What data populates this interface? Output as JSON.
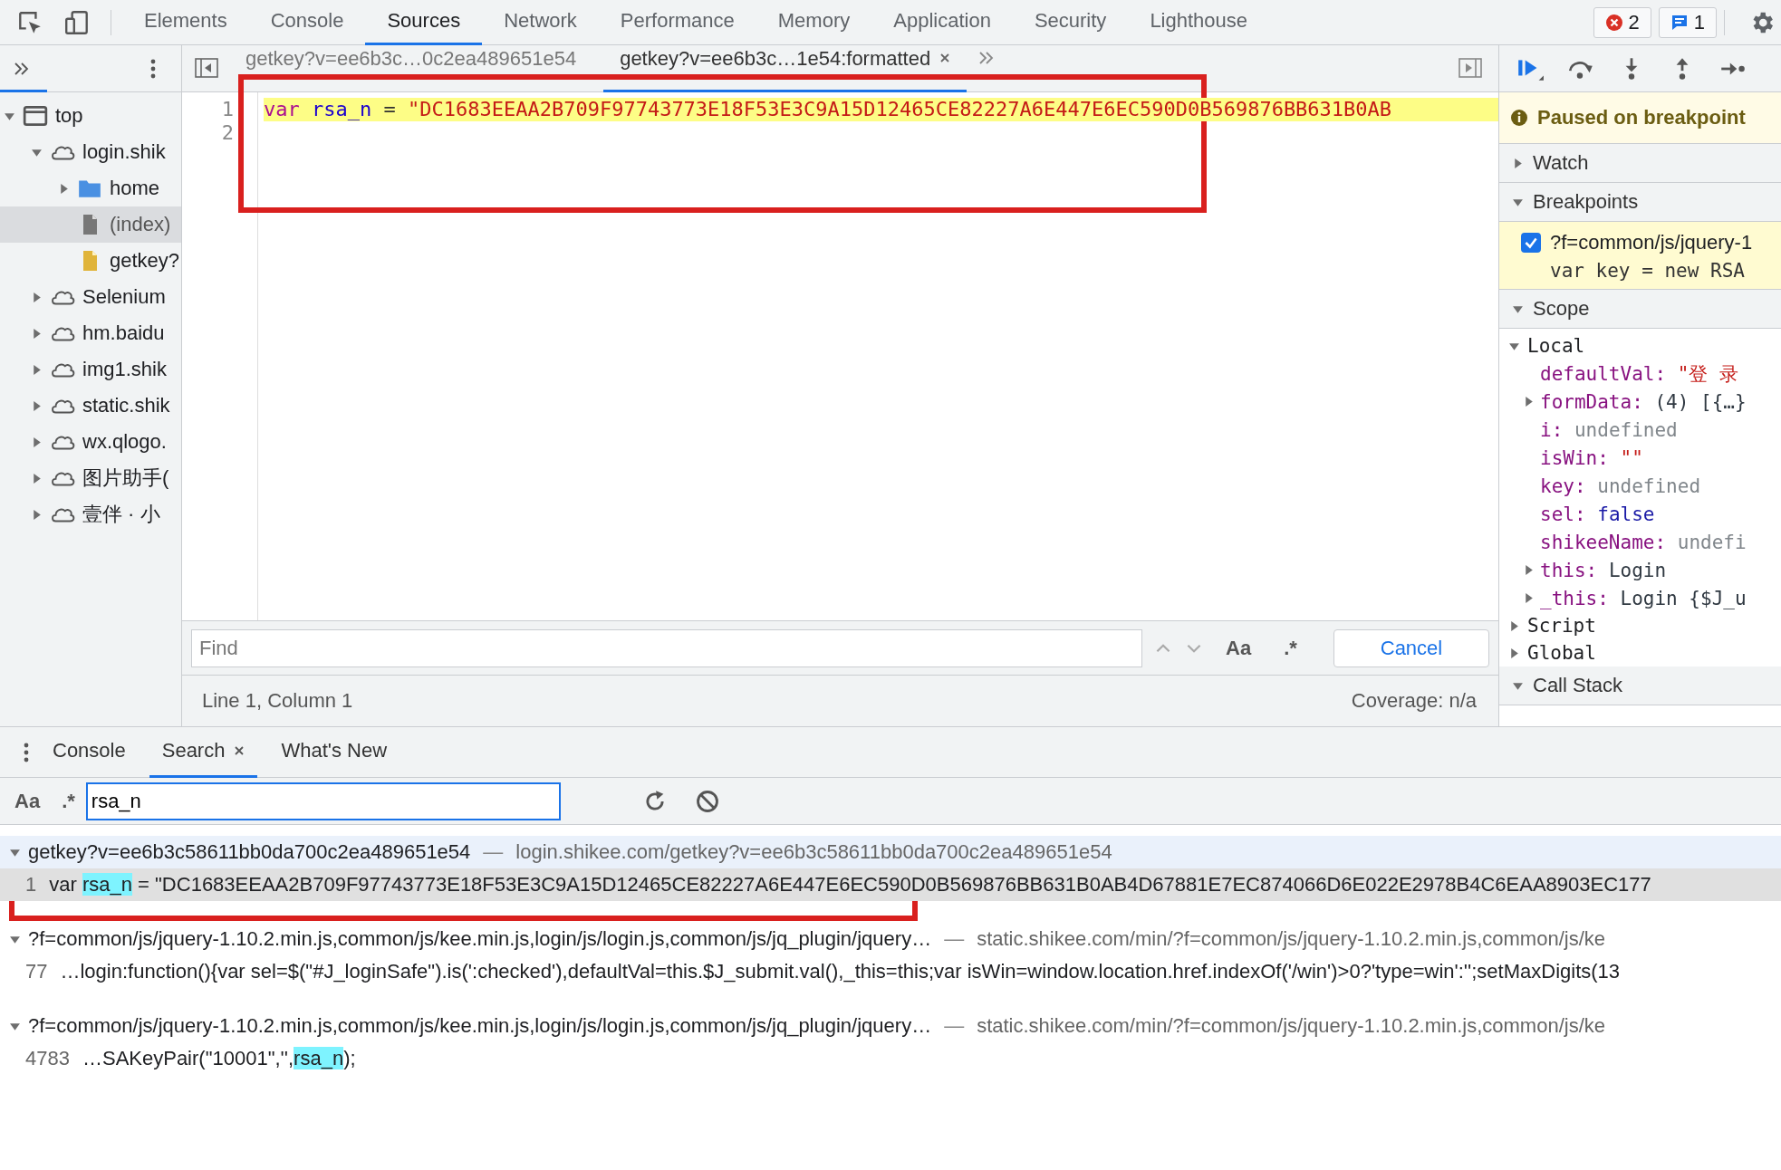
{
  "toolbar": {
    "tabs": [
      {
        "label": "Elements",
        "selected": false
      },
      {
        "label": "Console",
        "selected": false
      },
      {
        "label": "Sources",
        "selected": true
      },
      {
        "label": "Network",
        "selected": false
      },
      {
        "label": "Performance",
        "selected": false
      },
      {
        "label": "Memory",
        "selected": false
      },
      {
        "label": "Application",
        "selected": false
      },
      {
        "label": "Security",
        "selected": false
      },
      {
        "label": "Lighthouse",
        "selected": false
      }
    ],
    "errors": "2",
    "messages": "1"
  },
  "navigator": {
    "tree": [
      {
        "label": "top",
        "kind": "frame",
        "expanded": true,
        "selected": false,
        "children": [
          {
            "label": "login.shik",
            "kind": "domain",
            "expanded": true,
            "selected": false,
            "children": [
              {
                "label": "home",
                "kind": "folder",
                "expanded": false,
                "selected": false
              },
              {
                "label": "(index)",
                "kind": "file",
                "selected": true
              },
              {
                "label": "getkey?",
                "kind": "script",
                "selected": false
              }
            ]
          },
          {
            "label": "Selenium",
            "kind": "domain",
            "expanded": false,
            "selected": false
          },
          {
            "label": "hm.baidu",
            "kind": "domain",
            "expanded": false,
            "selected": false
          },
          {
            "label": "img1.shik",
            "kind": "domain",
            "expanded": false,
            "selected": false
          },
          {
            "label": "static.shik",
            "kind": "domain",
            "expanded": false,
            "selected": false
          },
          {
            "label": "wx.qlogo.",
            "kind": "domain",
            "expanded": false,
            "selected": false
          },
          {
            "label": "图片助手(",
            "kind": "domain",
            "expanded": false,
            "selected": false
          },
          {
            "label": "壹伴 · 小",
            "kind": "domain",
            "expanded": false,
            "selected": false
          }
        ]
      }
    ]
  },
  "editor": {
    "tabs": [
      {
        "label": "getkey?v=ee6b3c…0c2ea489651e54",
        "selected": false
      },
      {
        "label": "getkey?v=ee6b3c…1e54:formatted",
        "selected": true
      }
    ],
    "lines": [
      {
        "number": "1",
        "highlighted": true,
        "tokens": [
          {
            "kind": "keyword",
            "text": "var"
          },
          {
            "kind": "variable",
            "text": "rsa_n"
          },
          {
            "kind": "operator",
            "text": "="
          },
          {
            "kind": "string",
            "text": "\"DC1683EEAA2B709F97743773E18F53E3C9A15D12465CE82227A6E447E6EC590D0B569876BB631B0AB"
          }
        ]
      },
      {
        "number": "2",
        "highlighted": false
      }
    ],
    "find": {
      "placeholder": "Find",
      "match_case": "Aa",
      "regex": ".*",
      "cancel": "Cancel"
    },
    "status": {
      "position": "Line 1, Column 1",
      "coverage": "Coverage: n/a"
    }
  },
  "debugger": {
    "banner": "Paused on breakpoint",
    "sections": [
      {
        "title": "Watch",
        "expanded": false
      },
      {
        "title": "Breakpoints",
        "expanded": true
      },
      {
        "title": "Scope",
        "expanded": true
      },
      {
        "title": "Call Stack",
        "expanded": true
      }
    ],
    "breakpoint": {
      "file": "?f=common/js/jquery-1",
      "code": "var key = new RSA",
      "checked": true
    },
    "scopes": [
      {
        "label": "Local",
        "expanded": true,
        "variables": [
          {
            "name": "defaultVal:",
            "value": "\"登  录",
            "kind": "string"
          },
          {
            "name": "formData:",
            "value": "(4) [{…}",
            "kind": "object",
            "expanded": false
          },
          {
            "name": "i:",
            "value": "undefined",
            "kind": "undefined"
          },
          {
            "name": "isWin:",
            "value": "\"\"",
            "kind": "string"
          },
          {
            "name": "key:",
            "value": "undefined",
            "kind": "undefined"
          },
          {
            "name": "sel:",
            "value": "false",
            "kind": "boolean"
          },
          {
            "name": "shikeeName:",
            "value": "undefi",
            "kind": "undefined"
          },
          {
            "name": "this:",
            "value": "Login",
            "kind": "object",
            "expanded": false
          },
          {
            "name": "_this:",
            "value": "Login {$J_u",
            "kind": "object",
            "expanded": false
          }
        ]
      },
      {
        "label": "Script",
        "expanded": false
      },
      {
        "label": "Global",
        "expanded": false
      }
    ]
  },
  "drawer": {
    "tabs": [
      {
        "label": "Console",
        "selected": false,
        "closable": false
      },
      {
        "label": "Search",
        "selected": true,
        "closable": true
      },
      {
        "label": "What's New",
        "selected": false,
        "closable": false
      }
    ],
    "search": {
      "match_case": "Aa",
      "regex": ".*",
      "value": "rsa_n"
    },
    "results": [
      {
        "file": "getkey?v=ee6b3c58611bb0da700c2ea489651e54",
        "separator": "—",
        "url": "login.shikee.com/getkey?v=ee6b3c58611bb0da700c2ea489651e54",
        "expanded": true,
        "selected": true,
        "matches": [
          {
            "line": "1",
            "selected": true,
            "segments": [
              {
                "text": "var ",
                "match": false
              },
              {
                "text": "rsa_n",
                "match": true
              },
              {
                "text": " = \"DC1683EEAA2B709F97743773E18F53E3C9A15D12465CE82227A6E447E6EC590D0B569876BB631B0AB4D67881E7EC874066D6E022E2978B4C6EAA8903EC177",
                "match": false
              }
            ]
          }
        ]
      },
      {
        "file": "?f=common/js/jquery-1.10.2.min.js,common/js/kee.min.js,login/js/login.js,common/js/jq_plugin/jquery…",
        "separator": "—",
        "url": "static.shikee.com/min/?f=common/js/jquery-1.10.2.min.js,common/js/ke",
        "expanded": true,
        "selected": false,
        "matches": [
          {
            "line": "77",
            "selected": false,
            "segments": [
              {
                "text": "…login:function(){var sel=$(\"#J_loginSafe\").is(':checked'),defaultVal=this.$J_submit.val(),_this=this;var isWin=window.location.href.indexOf('/win')>0?'type=win':'';setMaxDigits(13",
                "match": false
              }
            ]
          }
        ]
      },
      {
        "file": "?f=common/js/jquery-1.10.2.min.js,common/js/kee.min.js,login/js/login.js,common/js/jq_plugin/jquery…",
        "separator": "—",
        "url": "static.shikee.com/min/?f=common/js/jquery-1.10.2.min.js,common/js/ke",
        "expanded": true,
        "selected": false,
        "matches": [
          {
            "line": "4783",
            "selected": false,
            "segments": [
              {
                "text": "…SAKeyPair(\"10001\",'',",
                "match": false
              },
              {
                "text": "rsa_n",
                "match": true
              },
              {
                "text": ");",
                "match": false
              }
            ]
          }
        ]
      }
    ]
  }
}
